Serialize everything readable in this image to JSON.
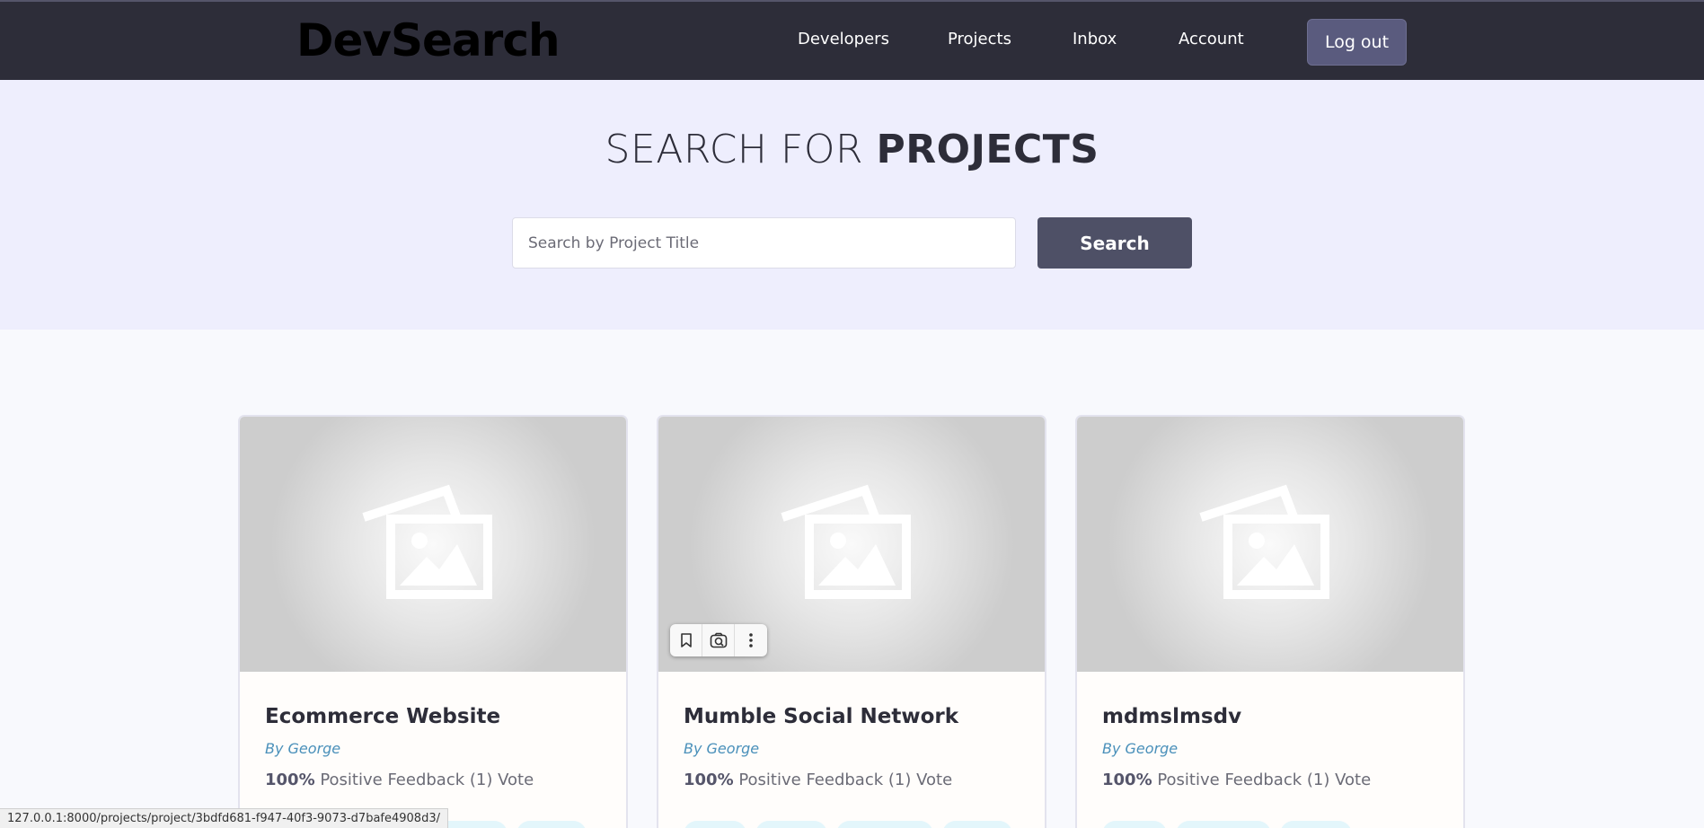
{
  "navbar": {
    "logo": "DevSearch",
    "links": [
      "Developers",
      "Projects",
      "Inbox",
      "Account"
    ],
    "logout_label": "Log out"
  },
  "hero": {
    "title_light": "SEARCH FOR",
    "title_bold": "PROJECTS",
    "search_placeholder": "Search by Project Title",
    "search_button": "Search"
  },
  "projects": [
    {
      "title": "Ecommerce Website",
      "author": "By George",
      "feedback_percent": "100%",
      "feedback_text": " Positive Feedback (1) Vote"
    },
    {
      "title": "Mumble Social Network",
      "author": "By George",
      "feedback_percent": "100%",
      "feedback_text": " Positive Feedback (1) Vote"
    },
    {
      "title": "mdmslmsdv",
      "author": "By George",
      "feedback_percent": "100%",
      "feedback_text": " Positive Feedback (1) Vote"
    }
  ],
  "image_toolbar": {
    "icons": [
      "bookmark-icon",
      "visual-search-icon",
      "more-options-icon"
    ]
  },
  "status_bar": {
    "url": "127.0.0.1:8000/projects/project/3bdfd681-f947-40f3-9073-d7bafe4908d3/"
  },
  "colors": {
    "navbar_bg": "#2d2d39",
    "hero_bg": "#eeeefd",
    "accent_button": "#4e5066",
    "author_link": "#4a90ba"
  }
}
